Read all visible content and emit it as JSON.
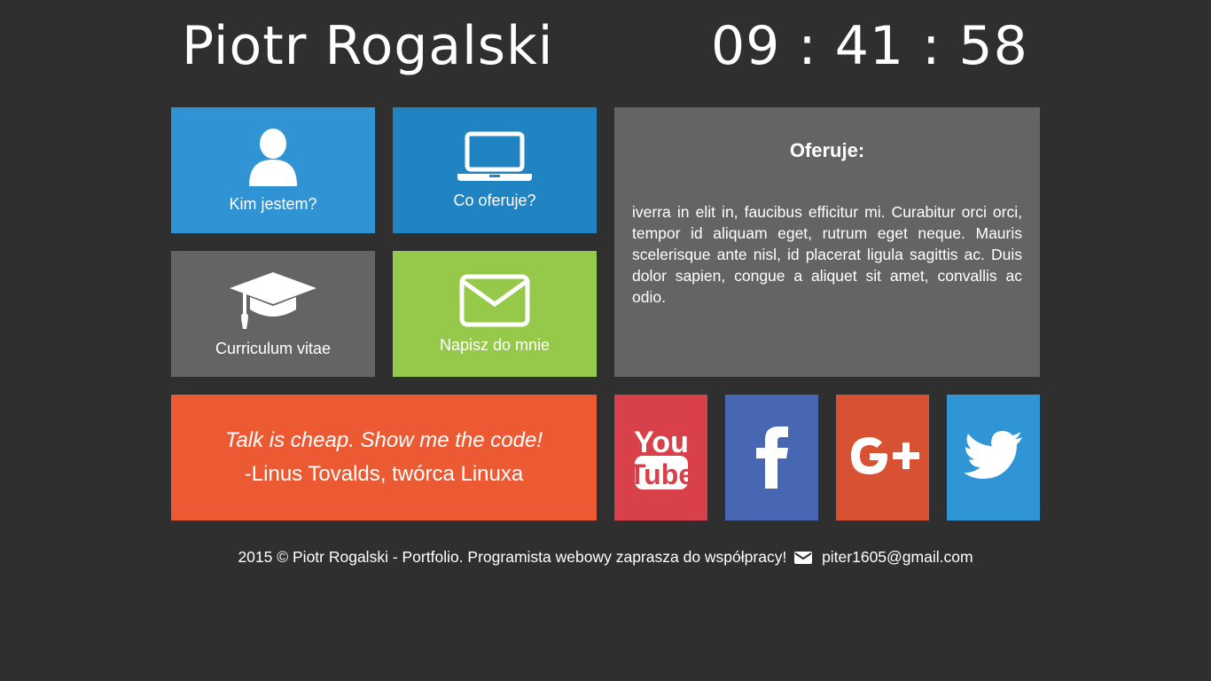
{
  "header": {
    "name": "Piotr Rogalski",
    "clock": "09 : 41 : 58"
  },
  "tiles": [
    {
      "label": "Kim jestem?",
      "icon": "user-icon",
      "color": "#3094d4"
    },
    {
      "label": "Co oferuje?",
      "icon": "laptop-icon",
      "color": "#2184c2"
    },
    {
      "label": "Curriculum vitae",
      "icon": "graduation-cap-icon",
      "color": "#646464"
    },
    {
      "label": "Napisz do mnie",
      "icon": "envelope-icon",
      "color": "#96c84a"
    }
  ],
  "panel": {
    "title": "Oferuje:",
    "body": "iverra in elit in, faucibus efficitur mi. Curabitur orci orci, tempor id aliquam eget, rutrum eget neque. Mauris scelerisque ante nisl, id placerat ligula sagittis ac. Duis dolor sapien, congue a aliquet sit amet, convallis ac odio.",
    "color": "#646464"
  },
  "quote": {
    "text": "Talk is cheap. Show me the code!",
    "author": "-Linus Tovalds, twórca Linuxa",
    "color": "#ec5a34"
  },
  "social": [
    {
      "name": "youtube-icon",
      "color": "#d8414a"
    },
    {
      "name": "facebook-icon",
      "color": "#4767b3"
    },
    {
      "name": "google-plus-icon",
      "color": "#d95133"
    },
    {
      "name": "twitter-icon",
      "color": "#2f95d4"
    }
  ],
  "footer": {
    "text": "2015 © Piotr Rogalski - Portfolio. Programista webowy zaprasza do współpracy!",
    "email": "piter1605@gmail.com"
  },
  "colors": {
    "background": "#2f2f2f",
    "text": "#ffffff"
  }
}
